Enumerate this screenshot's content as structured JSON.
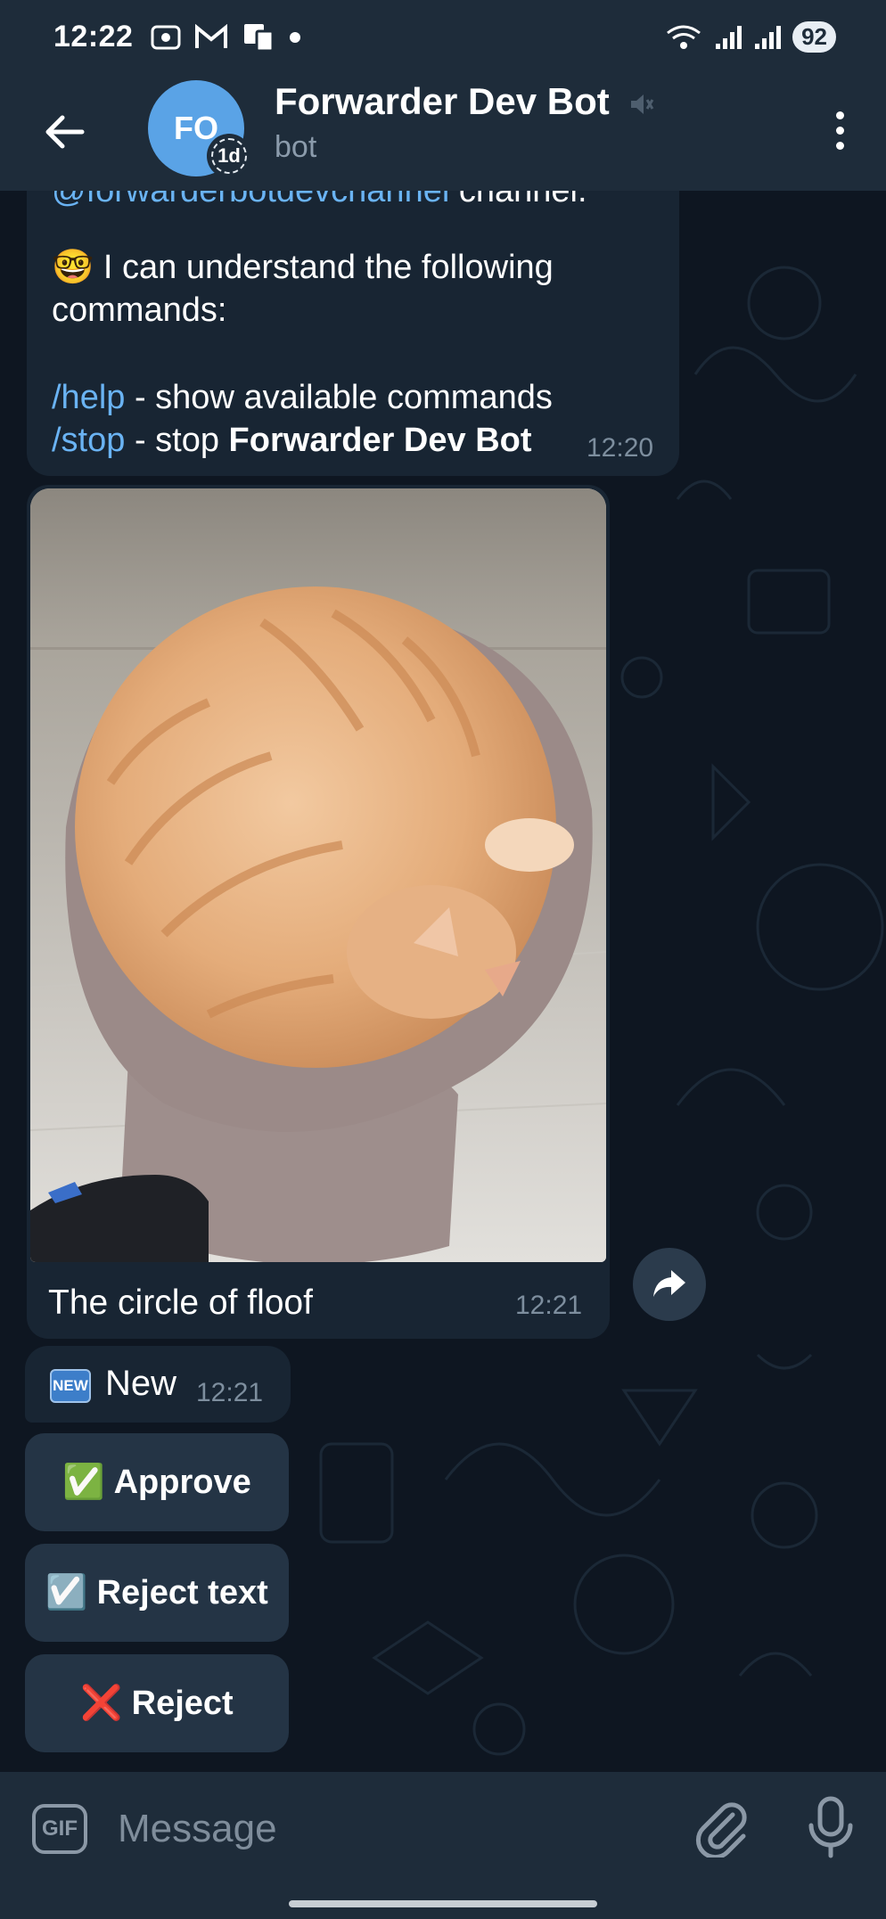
{
  "status_bar": {
    "time": "12:22",
    "battery": "92",
    "left_icons": [
      "screenshot-icon",
      "gmail-icon",
      "notification-icon",
      "dot-icon"
    ],
    "right_icons": [
      "wifi-icon",
      "signal-icon",
      "signal-icon"
    ]
  },
  "header": {
    "avatar_initials": "FO",
    "avatar_badge": "1d",
    "title": "Forwarder Dev Bot",
    "subtitle": "bot"
  },
  "messages": {
    "welcome": {
      "partial_line_link": "@forwarderbotdevchannel",
      "partial_line_rest": " channel.",
      "emoji": "🤓",
      "line1": " I can understand the following",
      "line2": "commands:",
      "cmd1": "/help",
      "cmd1_desc": " - show available commands",
      "cmd2": "/stop",
      "cmd2_desc": " - stop ",
      "cmd2_bold": "Forwarder Dev Bot",
      "time": "12:20"
    },
    "photo": {
      "caption": "The circle of floof",
      "time": "12:21"
    },
    "status": {
      "badge": "NEW",
      "label": "New",
      "time": "12:21"
    }
  },
  "keyboard": [
    {
      "emoji": "✅",
      "label": "Approve"
    },
    {
      "emoji": "☑️",
      "label": "Reject text"
    },
    {
      "emoji": "❌",
      "label": "Reject"
    }
  ],
  "input": {
    "gif_label": "GIF",
    "placeholder": "Message"
  },
  "colors": {
    "background": "#0e1621",
    "bar": "#1e2c3a",
    "bubble": "#182533",
    "link": "#6ab3f3",
    "avatar": "#5aa3e6"
  }
}
